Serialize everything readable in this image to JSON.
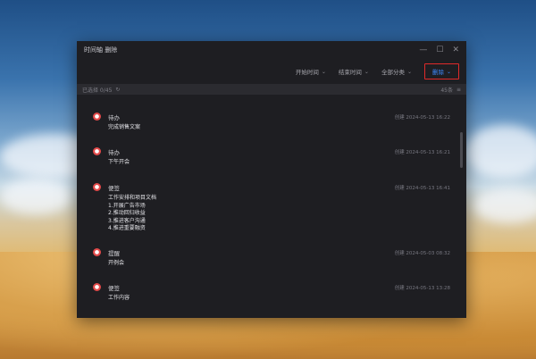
{
  "window": {
    "title": "时间轴 删除",
    "controls": {
      "minimize": "—",
      "maximize": "☐",
      "close": "✕"
    }
  },
  "toolbar": {
    "filters": [
      {
        "label": "开始时间",
        "icon": "chevron-down-icon"
      },
      {
        "label": "结束时间",
        "icon": "chevron-down-icon"
      },
      {
        "label": "全部分类",
        "icon": "chevron-down-icon"
      }
    ],
    "delete_label": "删除",
    "colors": {
      "delete_border": "#e02a2a",
      "delete_text": "#3d8bff"
    }
  },
  "statusbar": {
    "left": "已选择 0/45",
    "right": "45条"
  },
  "items": [
    {
      "category": "待办",
      "timestamp": "创建 2024-05-13 16:22",
      "body": "完成销售文案",
      "color": "#e34a4a"
    },
    {
      "category": "待办",
      "timestamp": "创建 2024-05-13 16:21",
      "body": "下午开会",
      "color": "#e34a4a"
    },
    {
      "category": "便签",
      "timestamp": "创建 2024-05-13 16:41",
      "body": "工作安排和项目文档\n1.开展广告市场\n2.推动回归收益\n3.推进客户沟通\n4.推进重要融资",
      "color": "#e34a4a"
    },
    {
      "category": "提醒",
      "timestamp": "创建 2024-05-03 08:32",
      "body": "开例会",
      "color": "#e34a4a"
    },
    {
      "category": "便签",
      "timestamp": "创建 2024-05-13 13:28",
      "body": "工作内容",
      "color": "#e34a4a"
    }
  ]
}
